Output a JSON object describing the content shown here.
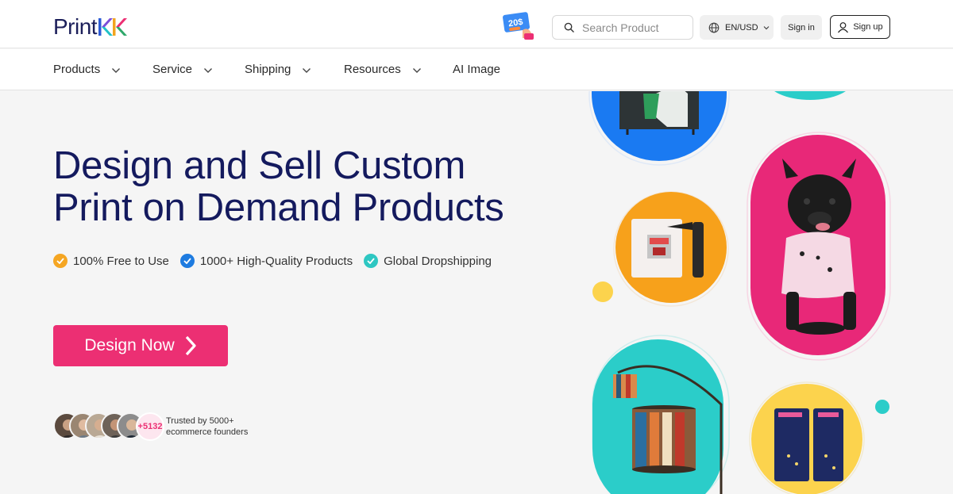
{
  "brand": {
    "name": "PrintKK",
    "text_part": "Print"
  },
  "header": {
    "search_placeholder": "Search Product",
    "lang_label": "EN/USD",
    "signin_label": "Sign in",
    "signup_label": "Sign up",
    "promo_badge": "20$"
  },
  "nav": {
    "items": [
      {
        "label": "Products",
        "has_dropdown": true
      },
      {
        "label": "Service",
        "has_dropdown": true
      },
      {
        "label": "Shipping",
        "has_dropdown": true
      },
      {
        "label": "Resources",
        "has_dropdown": true
      },
      {
        "label": "AI Image",
        "has_dropdown": false
      }
    ]
  },
  "hero": {
    "title_line1": "Design and Sell Custom",
    "title_line2": "Print on Demand Products",
    "features": [
      {
        "label": "100% Free to Use",
        "color": "#f5a623"
      },
      {
        "label": "1000+ High-Quality Products",
        "color": "#1e7be0"
      },
      {
        "label": "Global Dropshipping",
        "color": "#2ec7c2"
      }
    ],
    "cta_label": "Design Now",
    "founders_count": "+5132",
    "trusted_line1": "Trusted by 5000+",
    "trusted_line2": "ecommerce founders"
  },
  "colors": {
    "accent": "#ec2f73",
    "navy": "#141a5e",
    "blue": "#1a7af2",
    "orange": "#f7a11b",
    "pink": "#e82878",
    "teal": "#2bcdc9",
    "yellow": "#fcd34d"
  }
}
